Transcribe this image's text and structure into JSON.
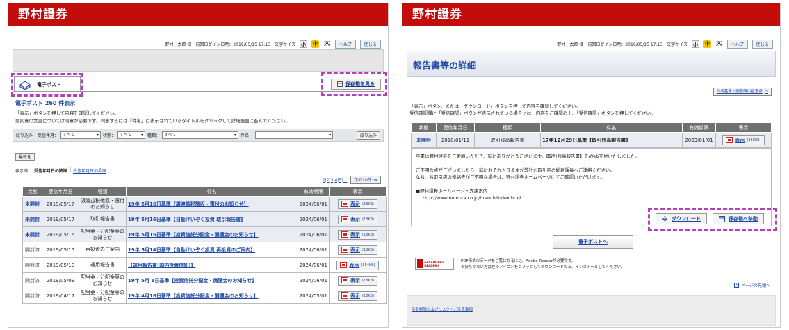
{
  "left": {
    "brand": "野村證券",
    "user": {
      "name": "野村　太郎 様",
      "login_label": "前回ログイン日時：",
      "login_time": "2019/05/15 17:13",
      "font_size_label": "文字サイズ",
      "font_small": "小",
      "font_medium": "中",
      "font_large": "大",
      "help": "ヘルプ",
      "close": "閉じる"
    },
    "tab_label": "電子ポスト",
    "save_box_button": "保存箱を見る",
    "count_title": "電子ポスト 260 件表示",
    "instructions": [
      "「表示」ボタンを押して内容を確認してください。",
      "要同意の文書については同意が必要です。同意するには「件名」に表示されているタイトルをクリックして詳細画面に進んでください。"
    ],
    "filter": {
      "label": "絞り込み",
      "received_label": "受信年月：",
      "received_value": "すべて",
      "status_label": "状態：",
      "status_value": "すべて",
      "type_label": "種類：",
      "type_value": "すべて",
      "subject_label": "件名：",
      "subject_value": "",
      "button": "絞り込み"
    },
    "refresh_button": "最新化",
    "sort": {
      "label": "表示順：",
      "current": "受信年月日の降順",
      "separator": "|",
      "alt": "受信年月日の昇順"
    },
    "pagination": {
      "pages": "1|2|3|4|5|…",
      "next": "次の20件 ≫"
    },
    "columns": [
      "状態",
      "受信年月日",
      "種類",
      "件名",
      "有効期限",
      "表示"
    ],
    "rows": [
      {
        "status": "未開封",
        "date": "2019/05/17",
        "type": "譲渡益税徴収・還付のお知らせ",
        "subject": "19年 5月16日基準【譲渡益税徴収・還付のお知らせ】",
        "expiry": "2024/06/01",
        "view": "表示",
        "size": "(18KB)"
      },
      {
        "status": "未開封",
        "date": "2019/05/17",
        "type": "取引報告書",
        "subject": "19年 5月16日基準【自動けいぞく投資 取引報告書】",
        "expiry": "2024/06/01",
        "view": "表示",
        "size": "(13KB)"
      },
      {
        "status": "未開封",
        "date": "2019/05/16",
        "type": "配当金・分配金等のお知らせ",
        "subject": "19年 5月15日基準【投資信託分配金・償還金のお知らせ】",
        "expiry": "2024/06/01",
        "view": "表示",
        "size": "(18KB)"
      },
      {
        "status": "開封済",
        "date": "2019/05/15",
        "type": "再投資のご案内",
        "subject": "19年 5月14日基準【自動けいぞく投資 再投資のご案内】",
        "expiry": "2024/06/01",
        "view": "表示",
        "size": "(18KB)"
      },
      {
        "status": "開封済",
        "date": "2019/05/10",
        "type": "運用報告書",
        "subject": "【運用報告書(国内投資信託)】",
        "expiry": "2024/06/01",
        "view": "表示",
        "size": "(354KB)"
      },
      {
        "status": "開封済",
        "date": "2019/05/09",
        "type": "配当金・分配金等のお知らせ",
        "subject": "19年 5月 8日基準【投資信託分配金・償還金のお知らせ】",
        "expiry": "2024/06/01",
        "view": "表示",
        "size": "(18KB)"
      },
      {
        "status": "開封済",
        "date": "2019/04/17",
        "type": "配当金・分配金等のお知らせ",
        "subject": "19年 4月16日基準【投資信託分配金・償還金のお知らせ】",
        "expiry": "2024/05/01",
        "view": "表示",
        "size": "(18KB)"
      }
    ]
  },
  "right": {
    "brand": "野村證券",
    "user": {
      "name": "野村　太郎 様",
      "login_label": "前回ログイン日時：",
      "login_time": "2019/05/15 17:13",
      "font_size_label": "文字サイズ",
      "font_small": "小",
      "font_medium": "中",
      "font_large": "大",
      "help": "ヘルプ",
      "close": "閉じる"
    },
    "page_title": "報告書等の詳細",
    "notes_button": "作成基準・閲覧時の留意点",
    "instructions": [
      "「表示」ボタン、または「ダウンロード」ボタンを押して内容を確認してください。",
      "受信確認欄に「受信確認」ボタンが表示されている場合には、内容をご確認の上、「受信確認」ボタンを押してください。"
    ],
    "columns": [
      "状態",
      "受信年月日",
      "種類",
      "件名",
      "有効期限",
      "表示"
    ],
    "row": {
      "status": "未開封",
      "date": "2018/01/11",
      "type": "取引残高報告書",
      "subject": "17年12月29日基準【取引残高報告書】",
      "expiry": "2023/01/01",
      "view": "表示",
      "size": "(338KB)"
    },
    "message": [
      "平素は野村證券をご愛顧いただき、誠にありがとうございます。【取引残高報告書】をWeb交付いたしました。",
      "ご不明な点がございましたら、誠におそれ入りますが弊社お取引店の総務課長へご連絡ください。",
      "なお、お取引店の連絡先がご不明な場合は、野村證券ホームページにてご確認いただけます。",
      "■野村證券ホームページ・支店案内",
      "http://www.nomura.co.jp/branch/index.html"
    ],
    "download_button": "ダウンロード",
    "move_button": "保存箱へ移動",
    "back_button": "電子ポストへ",
    "adobe_badge": "Get ADOBE® READER®",
    "adobe_note": [
      "PDF形式のデータをご覧になるには、Adobe Readerが必要です。",
      "お持ちでない方は左のアイコンをクリックしてダウンロードの上、インストールしてください。"
    ],
    "page_top": "ページの先頭へ",
    "footer_link": "手数料等およびリスク・ご注意事項"
  },
  "colors": {
    "brand_red": "#c30d0d",
    "link_blue": "#1d48a6",
    "highlight": "#b63fc0",
    "header_gray": "#707070"
  }
}
